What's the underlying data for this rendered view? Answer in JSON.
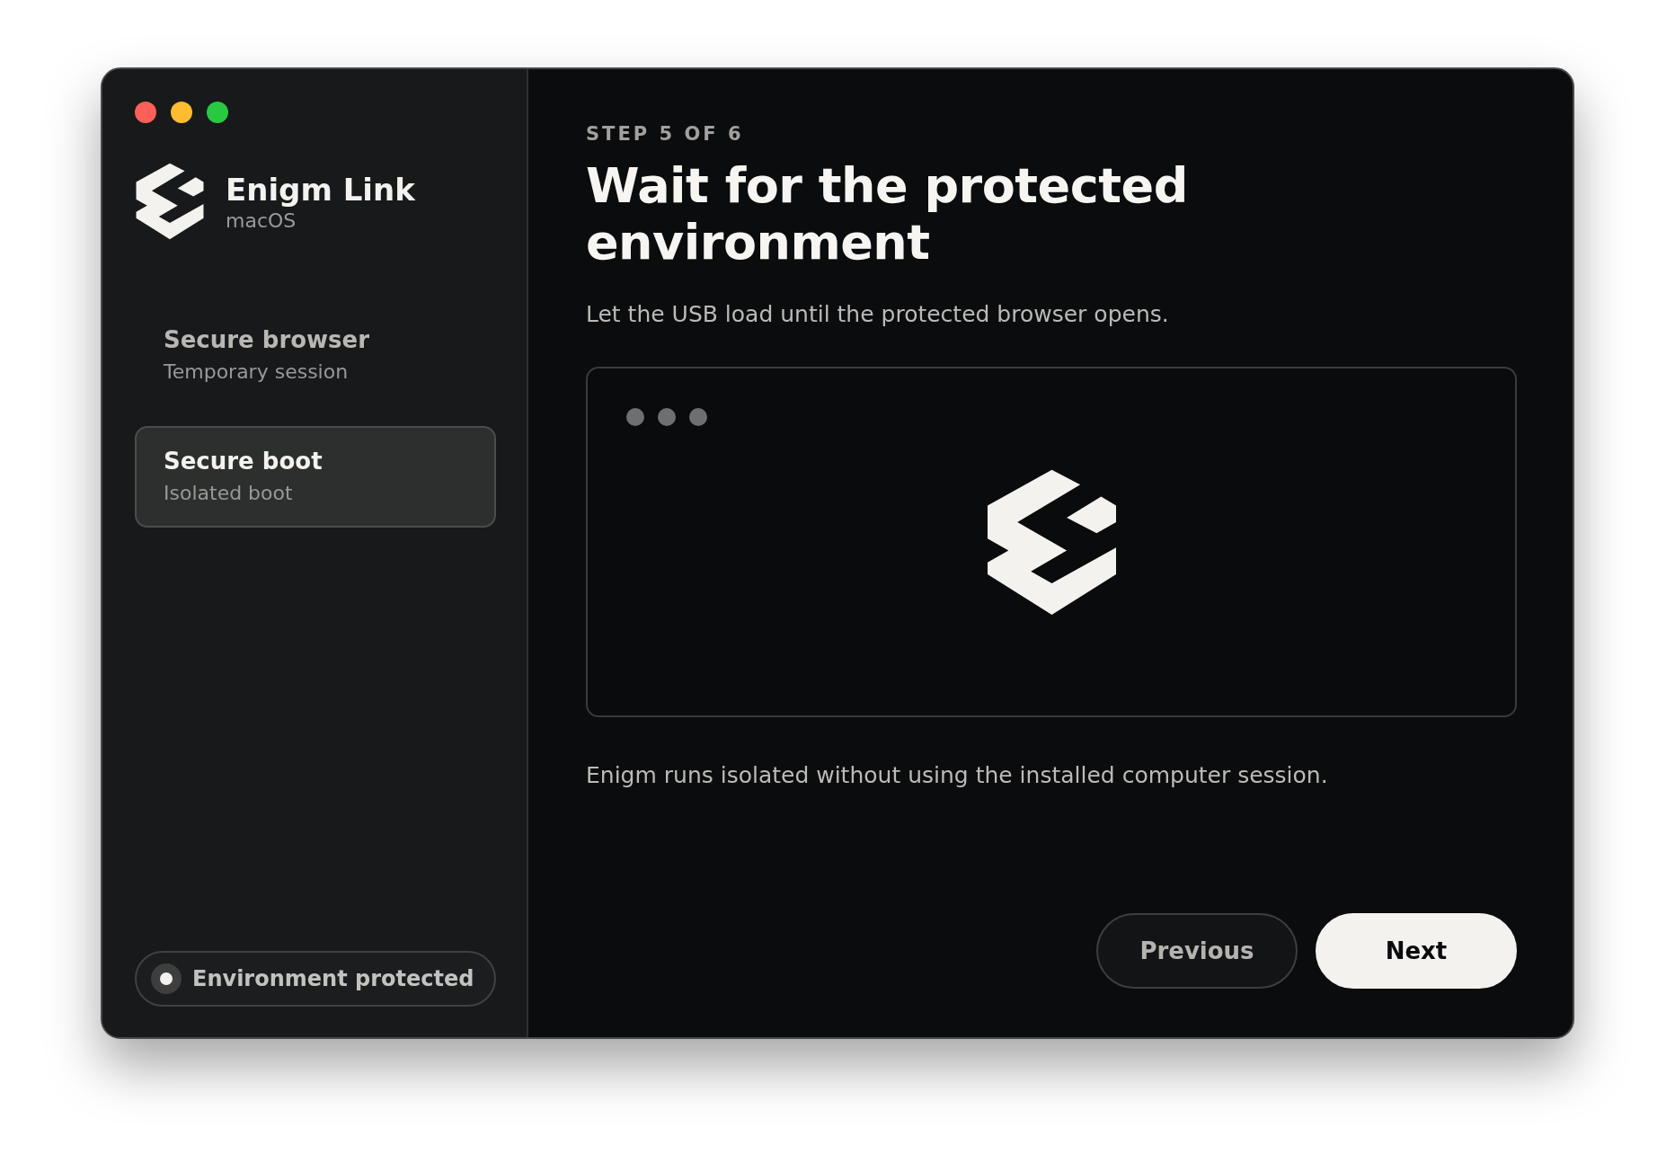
{
  "app": {
    "name": "Enigm Link",
    "platform": "macOS"
  },
  "steps": [
    {
      "title": "Secure browser",
      "subtitle": "Temporary session",
      "selected": false
    },
    {
      "title": "Secure boot",
      "subtitle": "Isolated boot",
      "selected": true
    }
  ],
  "status": {
    "label": "Environment protected",
    "on": true
  },
  "main": {
    "step_label": "STEP 5 OF 6",
    "title": "Wait for the protected environment",
    "description": "Let the USB load until the protected browser opens.",
    "note": "Enigm runs isolated without using the installed computer session."
  },
  "buttons": [
    {
      "label": "Previous",
      "kind": "secondary"
    },
    {
      "label": "Next",
      "kind": "primary"
    }
  ]
}
